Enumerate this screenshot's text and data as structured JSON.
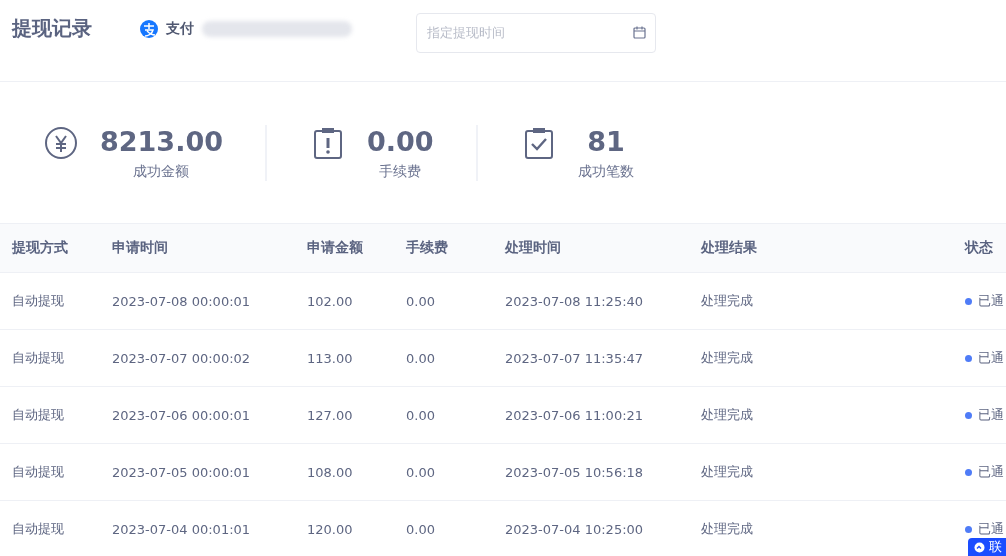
{
  "header": {
    "title": "提现记录",
    "account": {
      "label": "支付"
    },
    "date_field": {
      "placeholder": "指定提现时间"
    }
  },
  "stats": [
    {
      "kind": "money",
      "value": "8213.00",
      "label": "成功金额"
    },
    {
      "kind": "fee",
      "value": "0.00",
      "label": "手续费"
    },
    {
      "kind": "count",
      "value": "81",
      "label": "成功笔数"
    }
  ],
  "table": {
    "columns": [
      "提现方式",
      "申请时间",
      "申请金额",
      "手续费",
      "处理时间",
      "处理结果",
      "状态"
    ],
    "rows": [
      {
        "method": "自动提现",
        "applied": "2023-07-08 00:00:01",
        "amount": "102.00",
        "fee": "0.00",
        "processed": "2023-07-08 11:25:40",
        "result": "处理完成",
        "status": "已通",
        "color": "#4f7cf7"
      },
      {
        "method": "自动提现",
        "applied": "2023-07-07 00:00:02",
        "amount": "113.00",
        "fee": "0.00",
        "processed": "2023-07-07 11:35:47",
        "result": "处理完成",
        "status": "已通",
        "color": "#4f7cf7"
      },
      {
        "method": "自动提现",
        "applied": "2023-07-06 00:00:01",
        "amount": "127.00",
        "fee": "0.00",
        "processed": "2023-07-06 11:00:21",
        "result": "处理完成",
        "status": "已通",
        "color": "#4f7cf7"
      },
      {
        "method": "自动提现",
        "applied": "2023-07-05 00:00:01",
        "amount": "108.00",
        "fee": "0.00",
        "processed": "2023-07-05 10:56:18",
        "result": "处理完成",
        "status": "已通",
        "color": "#4f7cf7"
      },
      {
        "method": "自动提现",
        "applied": "2023-07-04 00:01:01",
        "amount": "120.00",
        "fee": "0.00",
        "processed": "2023-07-04 10:25:00",
        "result": "处理完成",
        "status": "已通",
        "color": "#4f7cf7"
      }
    ]
  },
  "contact_button": {
    "label": "联"
  }
}
